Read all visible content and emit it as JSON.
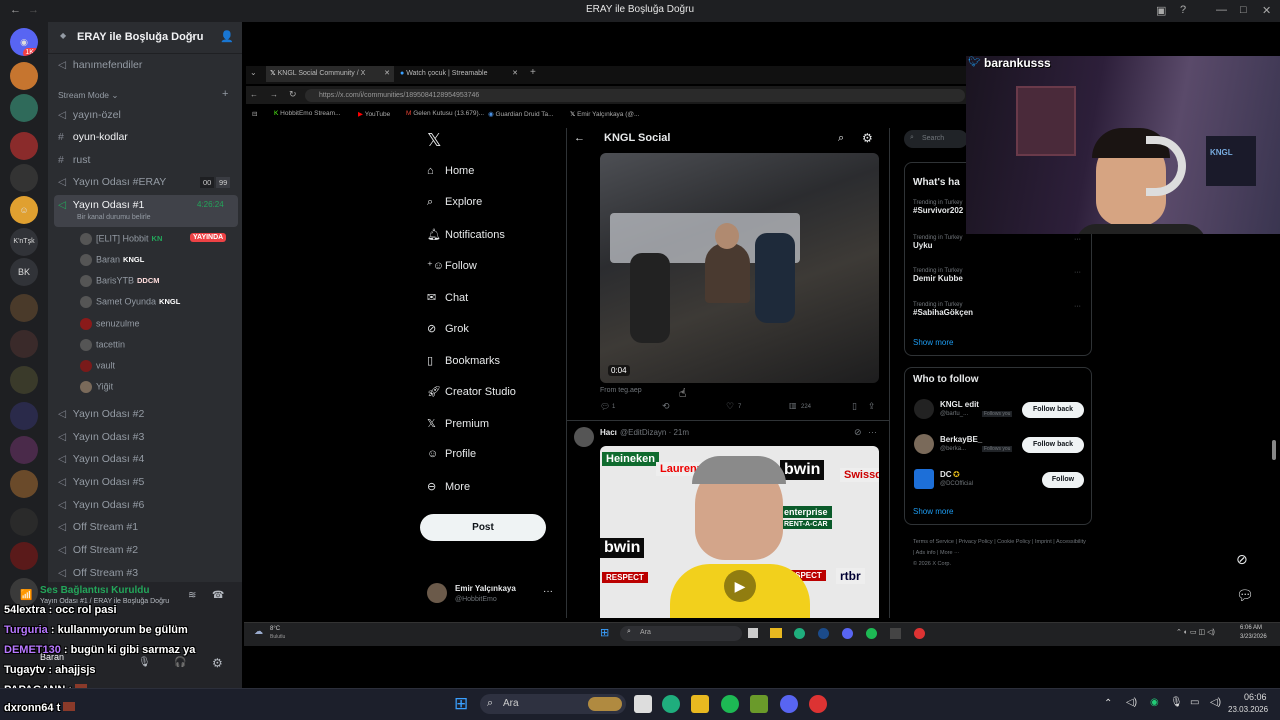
{
  "window": {
    "title": "ERAY ile Boşluğa Doğru"
  },
  "server": {
    "name": "ERAY ile Boşluğa Doğru"
  },
  "rail": {
    "badge_top": "1K+",
    "labels": [
      "K'nTşk",
      "BK"
    ]
  },
  "channels": {
    "pinned": "hanımefendiler",
    "category": "Stream Mode",
    "text": [
      "yayın-özel",
      "oyun-kodlar",
      "rust"
    ],
    "voice_eray": {
      "name": "Yayın Odası #ERAY",
      "count_a": "00",
      "count_b": "99"
    },
    "voice_active": {
      "name": "Yayın Odası #1",
      "timer": "4:26:24",
      "status": "Bir kanal durumu belirle"
    },
    "voice_users": [
      {
        "name": "[ELIT] Hobbit",
        "tag": "KN",
        "live": "YAYINDA"
      },
      {
        "name": "Baran",
        "tag": "KNGL"
      },
      {
        "name": "BarisYTB",
        "tag": "DDCM"
      },
      {
        "name": "Samet Oyunda",
        "tag": "KNGL"
      },
      {
        "name": "senuzulme"
      },
      {
        "name": "tacettin"
      },
      {
        "name": "vault"
      },
      {
        "name": "Yiğit"
      }
    ],
    "other_voice": [
      "Yayın Odası #2",
      "Yayın Odası #3",
      "Yayın Odası #4",
      "Yayın Odası #5",
      "Yayın Odası #6",
      "Off Stream #1",
      "Off Stream #2",
      "Off Stream #3"
    ]
  },
  "voice_panel": {
    "status": "Ses Bağlantısı Kuruldu",
    "location": "Yayın Odası #1 / ERAY ile Boşluğa Doğru",
    "user": "Baran"
  },
  "browser": {
    "tabs": [
      "KNGL Social Community / X",
      "Watch çocuk | Streamable"
    ],
    "url": "https://x.com/i/communities/1895084128954953746",
    "bookmarks": [
      "HobbitEmo Stream...",
      "YouTube",
      "Gelen Kutusu (13.679)...",
      "Guardian Druid Ta...",
      "Emir Yalçınkaya (@..."
    ]
  },
  "x": {
    "nav": [
      "Home",
      "Explore",
      "Notifications",
      "Follow",
      "Chat",
      "Grok",
      "Bookmarks",
      "Creator Studio",
      "Premium",
      "Profile",
      "More"
    ],
    "post_label": "Post",
    "profile_name": "Emir Yalçınkaya",
    "profile_handle": "@HobbitEmo",
    "community_title": "KNGL Social",
    "video1_time": "0:04",
    "video1_from": "From teg.aep",
    "video1_stats": {
      "replies": "1",
      "likes": "7",
      "views": "224"
    },
    "tweet2_author": "Hacı",
    "tweet2_meta": "@EditDizayn · 21m",
    "sponsors": [
      "Heineken",
      "Laurenn",
      "bwin",
      "Swissquote",
      "enterprise",
      "RENT-A-CAR",
      "RESPECT",
      "rtbr"
    ],
    "search_placeholder": "Search",
    "trends_title": "What's ha",
    "trends": [
      {
        "context": "Trending in Turkey",
        "topic": "#Survivor202"
      },
      {
        "context": "Trending in Turkey",
        "topic": "Uyku"
      },
      {
        "context": "Trending in Turkey",
        "topic": "Demir Kubbe"
      },
      {
        "context": "Trending in Turkey",
        "topic": "#SabihaGökçen"
      }
    ],
    "show_more": "Show more",
    "wtf_title": "Who to follow",
    "wtf": [
      {
        "name": "KNGL edit",
        "handle": "@bartu_...",
        "note": "Follows you",
        "button": "Follow back"
      },
      {
        "name": "BerkayBE_",
        "handle": "@berka...",
        "note": "Follows you",
        "button": "Follow back"
      },
      {
        "name": "DC",
        "handle": "@DCOfficial",
        "note": "",
        "button": "Follow"
      }
    ],
    "footer": "Terms of Service  |  Privacy Policy  |  Cookie Policy  |  Imprint  |  Accessibility  |  Ads info  |  More ···",
    "copyright": "© 2026 X Corp."
  },
  "stream_taskbar": {
    "weather": "8°C",
    "weather_desc": "Bulutlu",
    "search": "Ara",
    "time": "6:06 AM",
    "date": "3/23/2026"
  },
  "webcam": {
    "handle": "barankusss"
  },
  "chat": [
    {
      "user": "54lextra",
      "msg": ": occ rol pasi",
      "color": "#ffffff"
    },
    {
      "user": "Turguria",
      "msg": ": kullanmıyorum be gülüm",
      "color": "#b878ff"
    },
    {
      "user": "DEMET130",
      "msg": ": bugün ki gibi sarmaz ya",
      "color": "#b878ff"
    },
    {
      "user": "Tugaytv",
      "msg": ": ahajjsjs",
      "color": "#ffffff"
    },
    {
      "user": "PAPAGANN",
      "msg": ":",
      "color": "#ffffff"
    },
    {
      "user": "dxronn64",
      "msg": "t",
      "color": "#ffffff"
    }
  ],
  "taskbar": {
    "search": "Ara",
    "time": "06:06",
    "date": "23.03.2026",
    "weather": "8°C"
  }
}
